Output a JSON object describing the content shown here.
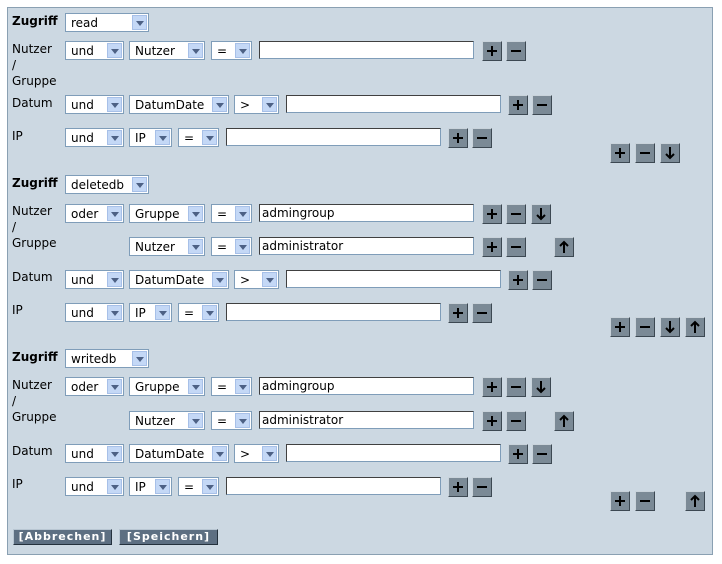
{
  "labels": {
    "access": "Zugriff",
    "user_group_line1": "Nutzer",
    "user_group_line2": "/",
    "user_group_line3": "Gruppe",
    "date": "Datum",
    "ip": "IP"
  },
  "rules": [
    {
      "access": "read",
      "conditions": [
        {
          "conj": "und",
          "field": "Nutzer",
          "op": "=",
          "value": ""
        },
        {
          "conj": "und",
          "field": "DatumDate",
          "op": ">",
          "value": ""
        },
        {
          "conj": "und",
          "field": "IP",
          "op": "=",
          "value": ""
        }
      ]
    },
    {
      "access": "deletedb",
      "conditions": [
        {
          "conj": "oder",
          "field": "Gruppe",
          "op": "=",
          "value": "admingroup"
        },
        {
          "conj": "",
          "field": "Nutzer",
          "op": "=",
          "value": "administrator"
        },
        {
          "conj": "und",
          "field": "DatumDate",
          "op": ">",
          "value": ""
        },
        {
          "conj": "und",
          "field": "IP",
          "op": "=",
          "value": ""
        }
      ]
    },
    {
      "access": "writedb",
      "conditions": [
        {
          "conj": "oder",
          "field": "Gruppe",
          "op": "=",
          "value": "admingroup"
        },
        {
          "conj": "",
          "field": "Nutzer",
          "op": "=",
          "value": "administrator"
        },
        {
          "conj": "und",
          "field": "DatumDate",
          "op": ">",
          "value": ""
        },
        {
          "conj": "und",
          "field": "IP",
          "op": "=",
          "value": ""
        }
      ]
    }
  ],
  "buttons": {
    "cancel": "[Abbrechen]",
    "save": "[Speichern]"
  },
  "icons": {
    "add": "plus-icon",
    "remove": "minus-icon",
    "down": "arrow-down-icon",
    "up": "arrow-up-icon"
  },
  "colors": {
    "panel_bg": "#ccd8e2",
    "button_bg": "#7b8a96",
    "footer_button_bg": "#5d6f82"
  }
}
